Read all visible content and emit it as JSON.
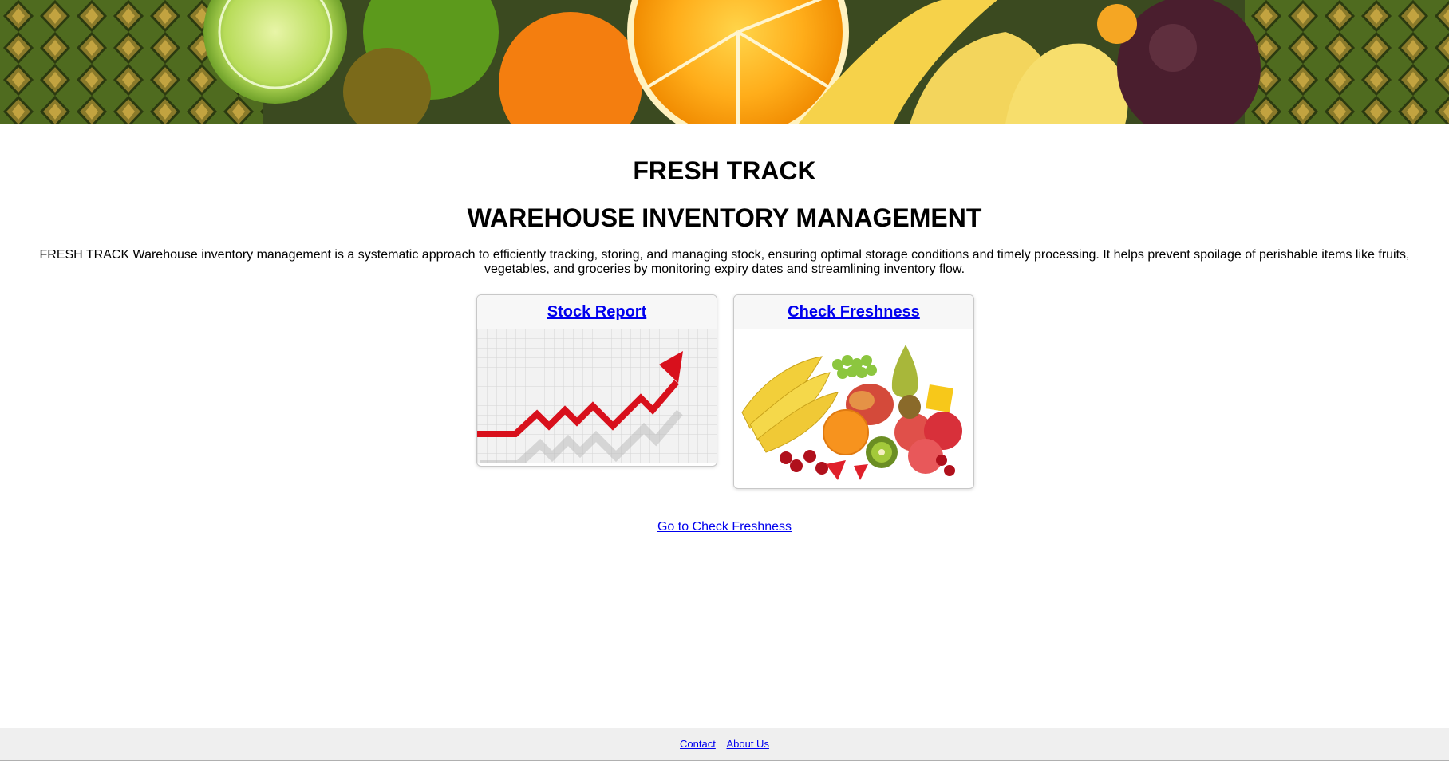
{
  "hero": {
    "image": "fruit-banner"
  },
  "header": {
    "title": "FRESH TRACK",
    "subtitle": "WAREHOUSE INVENTORY MANAGEMENT",
    "description": "FRESH TRACK Warehouse inventory management is a systematic approach to efficiently tracking, storing, and managing stock, ensuring optimal storage conditions and timely processing. It helps prevent spoilage of perishable items like fruits, vegetables, and groceries by monitoring expiry dates and streamlining inventory flow."
  },
  "cards": [
    {
      "label": "Stock Report",
      "image": "rising-chart-arrow"
    },
    {
      "label": "Check Freshness",
      "image": "fruit-assortment"
    }
  ],
  "links": {
    "goto_freshness": "Go to Check Freshness"
  },
  "footer": {
    "contact": "Contact",
    "about": "About Us"
  },
  "colors": {
    "link": "#0000ee",
    "arrow": "#d8101c",
    "footer_bg": "#efefef"
  }
}
